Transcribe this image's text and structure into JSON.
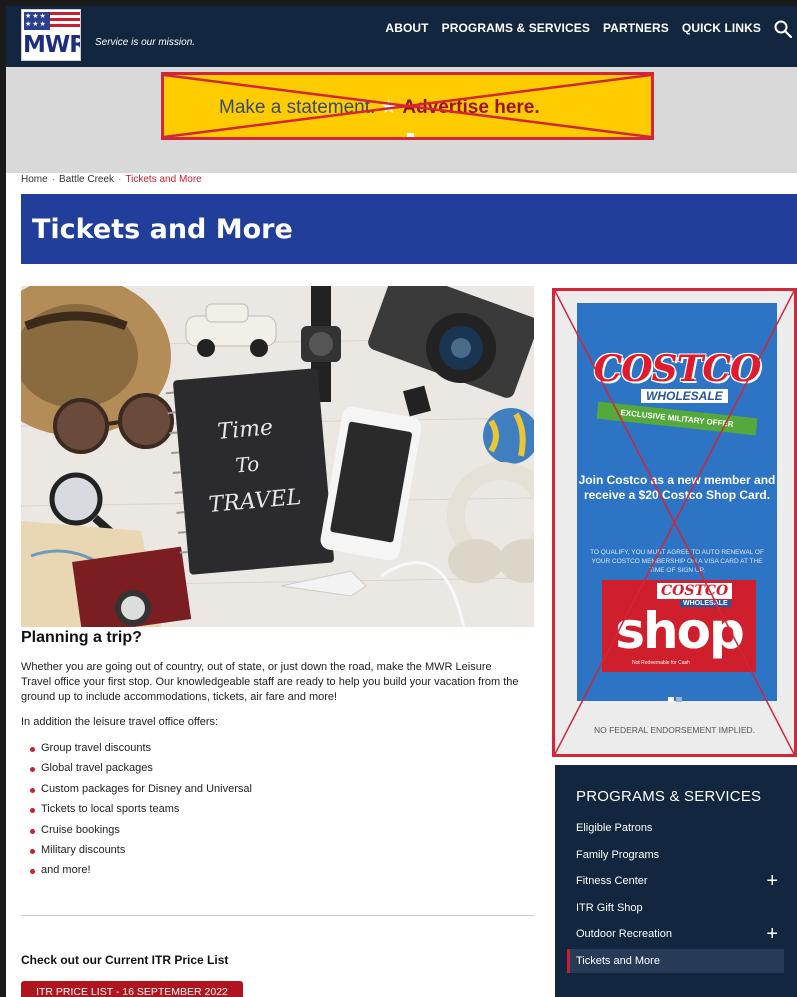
{
  "header": {
    "logo_text": "MWR",
    "tagline": "Service is our mission.",
    "nav": [
      "ABOUT",
      "PROGRAMS & SERVICES",
      "PARTNERS",
      "QUICK LINKS"
    ]
  },
  "banner_ad": {
    "text": "Make a statement.",
    "cta": "Advertise here."
  },
  "breadcrumbs": [
    "Home",
    "Battle Creek",
    "Tickets and More"
  ],
  "page_title": "Tickets and More",
  "hero_image": {
    "notebook_text": "Time To TRAVEL"
  },
  "content": {
    "heading": "Planning a trip?",
    "paragraph1": "Whether you are going out of country, out of state, or just down the road, make the MWR Leisure Travel office your first stop. Our knowledgeable staff are ready to help you build your vacation from the ground up to include accommodations, tickets, air fare and more!",
    "paragraph2": "In addition the leisure travel office offers:",
    "list": [
      "Group travel discounts",
      "Global travel packages",
      "Custom packages for Disney and Universal",
      "Tickets to local sports teams",
      "Cruise bookings",
      "Military discounts",
      "and more!"
    ],
    "price_heading": "Check out our Current ITR Price List",
    "price_button": "ITR PRICE LIST - 16 SEPTEMBER 2022"
  },
  "side_ad": {
    "brand": "COSTCO",
    "brand_sub": "WHOLESALE",
    "ribbon": "EXCLUSIVE MILITARY OFFER",
    "headline": "Join Costco as a new member and receive a $20 Costco Shop Card.",
    "fine_print": "TO QUALIFY, YOU MUST AGREE TO AUTO RENEWAL OF YOUR COSTCO MEMBERSHIP ON A VISA CARD AT THE TIME OF SIGN UP.",
    "card_word": "shop",
    "card_note": "Not Redeemable for Cash",
    "disclaimer": "NO FEDERAL ENDORSEMENT IMPLIED."
  },
  "programs": {
    "title": "PROGRAMS & SERVICES",
    "items": [
      {
        "label": "Eligible Patrons",
        "expand": ""
      },
      {
        "label": "Family Programs",
        "expand": ""
      },
      {
        "label": "Fitness Center",
        "expand": "+"
      },
      {
        "label": "ITR Gift Shop",
        "expand": ""
      },
      {
        "label": "Outdoor Recreation",
        "expand": "+"
      },
      {
        "label": "Tickets and More",
        "expand": ""
      }
    ]
  },
  "colors": {
    "header_navy": "#13263f",
    "title_blue": "#213e9a",
    "accent_red": "#c8202f",
    "ad_yellow": "#ffcc00",
    "costco_blue": "#2d74c4"
  }
}
